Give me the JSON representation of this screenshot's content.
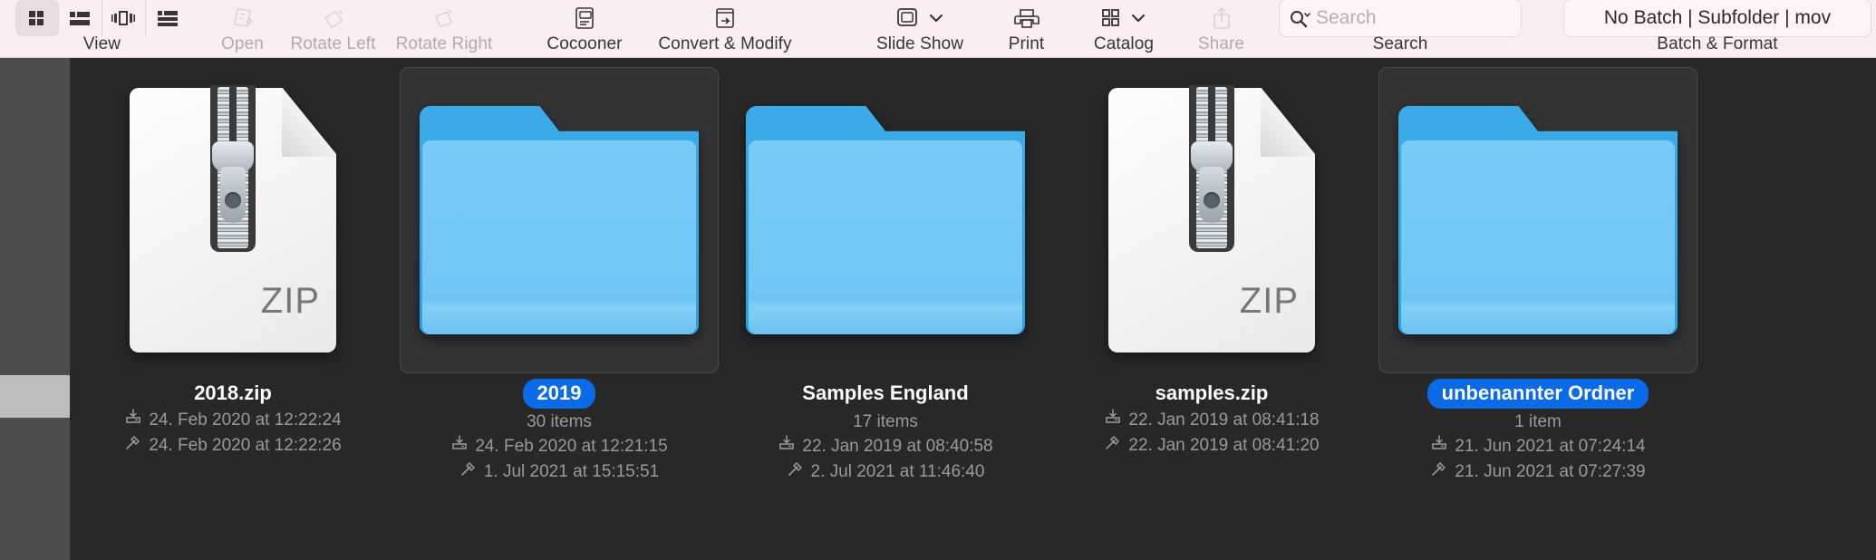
{
  "toolbar": {
    "groups": [
      {
        "id": "view",
        "label": "View",
        "dim": false
      },
      {
        "id": "open",
        "label": "Open",
        "dim": true
      },
      {
        "id": "rotl",
        "label": "Rotate Left",
        "dim": true
      },
      {
        "id": "rotr",
        "label": "Rotate Right",
        "dim": true
      },
      {
        "id": "cocoon",
        "label": "Cocooner",
        "dim": false
      },
      {
        "id": "convert",
        "label": "Convert & Modify",
        "dim": false
      },
      {
        "id": "slide",
        "label": "Slide Show",
        "dim": false
      },
      {
        "id": "print",
        "label": "Print",
        "dim": false
      },
      {
        "id": "catalog",
        "label": "Catalog",
        "dim": false
      },
      {
        "id": "share",
        "label": "Share",
        "dim": true
      },
      {
        "id": "search",
        "label": "Search",
        "dim": false
      },
      {
        "id": "batch",
        "label": "Batch & Format",
        "dim": false
      }
    ],
    "view_modes": [
      {
        "id": "grid-view",
        "icon": "grid-icon",
        "active": true
      },
      {
        "id": "list-view",
        "icon": "list-icon",
        "active": false
      },
      {
        "id": "filmstrip-view",
        "icon": "filmstrip-icon",
        "active": false
      },
      {
        "id": "detail-list-view",
        "icon": "detail-list-icon",
        "active": false
      }
    ],
    "search": {
      "placeholder": "Search",
      "value": ""
    },
    "batch": {
      "value": "No Batch | Subfolder | mov"
    }
  },
  "colors": {
    "toolbar_bg": "#faeef0",
    "canvas_bg": "#282828",
    "sidebar_bg": "#4d4d4d",
    "selection_blue": "#0a6ae8",
    "folder_blue": "#6fc4f2",
    "selected_cell_bg": "#333333"
  },
  "items": [
    {
      "name": "2018.zip",
      "kind": "zip",
      "selected": false,
      "badge_label": "ZIP",
      "count": "",
      "created": "24. Feb 2020 at 12:22:24",
      "modified": "24. Feb 2020 at 12:22:26"
    },
    {
      "name": "2019",
      "kind": "folder",
      "selected": true,
      "badge_label": "",
      "count": "30 items",
      "created": "24. Feb 2020 at 12:21:15",
      "modified": "1. Jul 2021 at 15:15:51"
    },
    {
      "name": "Samples England",
      "kind": "folder",
      "selected": false,
      "badge_label": "",
      "count": "17 items",
      "created": "22. Jan 2019 at 08:40:58",
      "modified": "2. Jul 2021 at 11:46:40"
    },
    {
      "name": "samples.zip",
      "kind": "zip",
      "selected": false,
      "badge_label": "ZIP",
      "count": "",
      "created": "22. Jan 2019 at 08:41:18",
      "modified": "22. Jan 2019 at 08:41:20"
    },
    {
      "name": "unbenannter Ordner",
      "kind": "folder",
      "selected": true,
      "badge_label": "",
      "count": "1 item",
      "created": "21. Jun 2021 at 07:24:14",
      "modified": "21. Jun 2021 at 07:27:39"
    }
  ]
}
